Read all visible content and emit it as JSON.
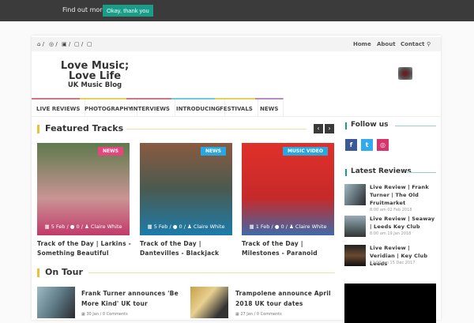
{
  "cookie": {
    "more": "Find out more.",
    "ok": "Okay, thank you"
  },
  "topbar": {
    "social_icons": [
      "home-icon",
      "instagram-icon",
      "facebook-icon",
      "twitter-icon",
      "youtube-icon"
    ],
    "links": [
      "Home",
      "About",
      "Contact"
    ]
  },
  "logo": {
    "line1": "Love Music;",
    "line2": "Love Life",
    "line3": "UK Music Blog"
  },
  "nav": [
    {
      "label": "LIVE REVIEWS",
      "color": "#d0777f"
    },
    {
      "label": "PHOTOGRAPHY",
      "color": "#e0d35a"
    },
    {
      "label": "INTERVIEWS",
      "color": "#d0777f"
    },
    {
      "label": "INTRODUCING",
      "color": "#6dcfd6"
    },
    {
      "label": "FESTIVALS",
      "color": "#e0d35a"
    },
    {
      "label": "NEWS",
      "color": "#b48fc0"
    }
  ],
  "featured": {
    "title": "Featured Tracks",
    "accent": "#e5c33c",
    "items": [
      {
        "badge": "NEWS",
        "badge_color": "#e8457f",
        "date": "5 Feb",
        "comments": "0",
        "author": "Claire White",
        "title": "Track of the Day | Larkins - Something Beautiful"
      },
      {
        "badge": "NEWS",
        "badge_color": "#2ba7e0",
        "date": "5 Feb",
        "comments": "0",
        "author": "Claire White",
        "title": "Track of the Day | Dantevilles - Blackjack"
      },
      {
        "badge": "MUSIC VIDEO",
        "badge_color": "#2ba7e0",
        "date": "1 Feb",
        "comments": "0",
        "author": "Claire White",
        "title": "Track of the Day | Milestones - Paranoid"
      }
    ]
  },
  "ontour": {
    "title": "On Tour",
    "items": [
      {
        "title": "Frank Turner announces 'Be More Kind' UK tour",
        "date": "30 Jan",
        "comments": "0 Comments"
      },
      {
        "title": "Trampolene announce April 2018 UK tour dates",
        "date": "27 Jan",
        "comments": "0 Comments"
      }
    ]
  },
  "sidebar": {
    "follow": "Follow us",
    "social": [
      {
        "icon": "facebook-icon",
        "glyph": "f",
        "color": "#3b5998"
      },
      {
        "icon": "twitter-icon",
        "glyph": "t",
        "color": "#33aaf0"
      },
      {
        "icon": "instagram-icon",
        "glyph": "◎",
        "color": "#d8336a"
      }
    ],
    "latest_title": "Latest Reviews",
    "reviews": [
      {
        "title": "Live Review | Frank Turner | The Old Fruitmarket",
        "date": "8:00 am 02 Feb 2018"
      },
      {
        "title": "Live Review | Seaway | Leeds Key Club",
        "date": "8:00 am 19 Jan 2018"
      },
      {
        "title": "Live Review | Veridian | Key Club Leeds",
        "date": "12:00 am 15 Dec 2017"
      }
    ]
  }
}
